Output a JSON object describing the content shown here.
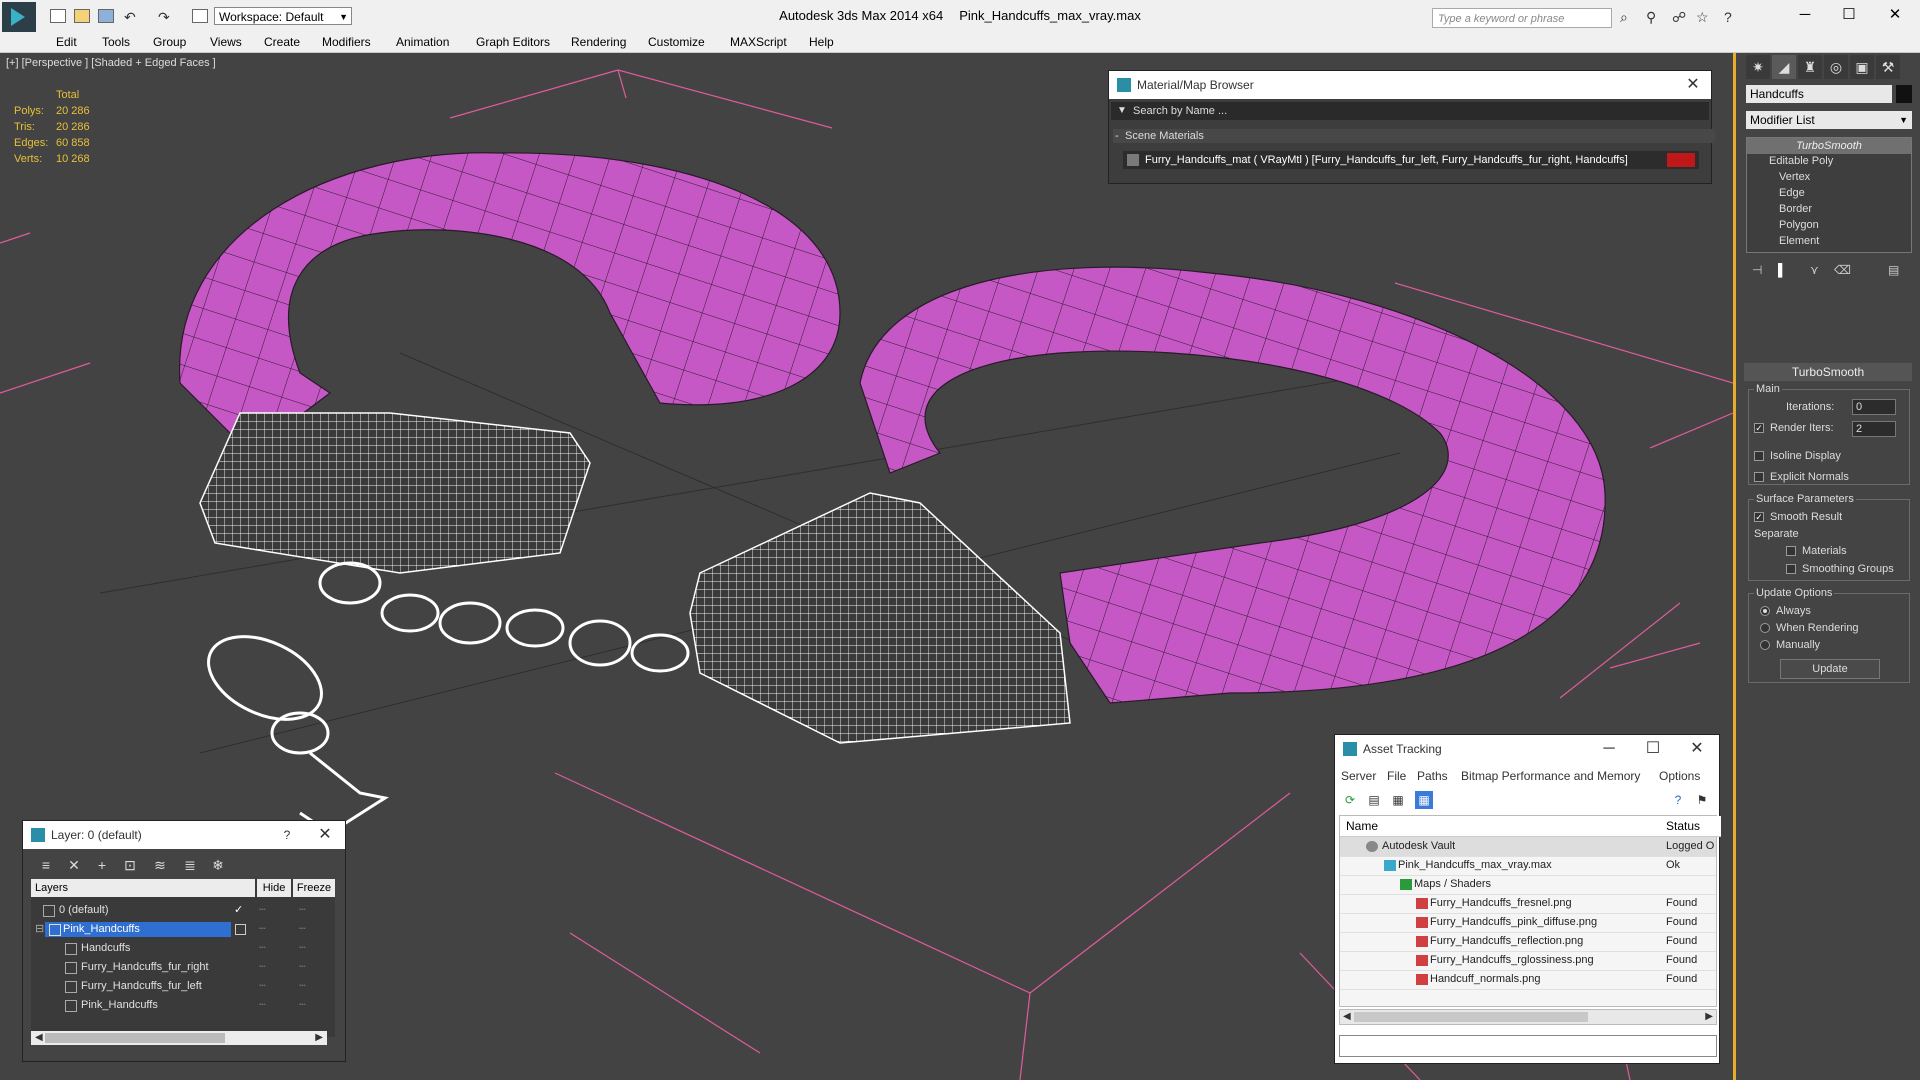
{
  "app": {
    "title": "Autodesk 3ds Max  2014 x64",
    "file": "Pink_Handcuffs_max_vray.max",
    "workspace": "Workspace: Default",
    "search_placeholder": "Type a keyword or phrase"
  },
  "menu": [
    "Edit",
    "Tools",
    "Group",
    "Views",
    "Create",
    "Modifiers",
    "Animation",
    "Graph Editors",
    "Rendering",
    "Customize",
    "MAXScript",
    "Help"
  ],
  "viewport": {
    "label": "[+] [Perspective ] [Shaded + Edged Faces ]",
    "stats": {
      "header": "Total",
      "rows": [
        {
          "label": "Polys:",
          "value": "20 286"
        },
        {
          "label": "Tris:",
          "value": "20 286"
        },
        {
          "label": "Edges:",
          "value": "60 858"
        },
        {
          "label": "Verts:",
          "value": "10 268"
        }
      ]
    },
    "colors": {
      "background": "#434343",
      "mesh": "#c257c2",
      "wire": "#ffffff",
      "grid": "#e05b9e"
    }
  },
  "command_panel": {
    "object_name": "Handcuffs",
    "modifier_list": "Modifier List",
    "stack": [
      "TurboSmooth",
      "Editable Poly",
      "Vertex",
      "Edge",
      "Border",
      "Polygon",
      "Element"
    ],
    "turbosmooth": {
      "title": "TurboSmooth",
      "main": "Main",
      "iterations_label": "Iterations:",
      "iterations": "0",
      "render_iters_label": "Render Iters:",
      "render_iters": "2",
      "isoline": "Isoline Display",
      "explicit": "Explicit Normals",
      "surface": "Surface Parameters",
      "smooth_result": "Smooth Result",
      "separate": "Separate",
      "materials": "Materials",
      "smoothing_groups": "Smoothing Groups",
      "update_options": "Update Options",
      "always": "Always",
      "when_rendering": "When Rendering",
      "manually": "Manually",
      "update": "Update"
    }
  },
  "material_browser": {
    "title": "Material/Map Browser",
    "search": "Search by Name ...",
    "section": "Scene Materials",
    "item": "Furry_Handcuffs_mat  ( VRayMtl ) [Furry_Handcuffs_fur_left, Furry_Handcuffs_fur_right, Handcuffs]",
    "swatch_color": "#c01818"
  },
  "layer_panel": {
    "title": "Layer: 0 (default)",
    "help": "?",
    "col_layers": "Layers",
    "col_hide": "Hide",
    "col_freeze": "Freeze",
    "rows": [
      {
        "name": "0 (default)"
      },
      {
        "name": "Pink_Handcuffs"
      },
      {
        "name": "Handcuffs"
      },
      {
        "name": "Furry_Handcuffs_fur_right"
      },
      {
        "name": "Furry_Handcuffs_fur_left"
      },
      {
        "name": "Pink_Handcuffs"
      }
    ]
  },
  "asset_tracking": {
    "title": "Asset Tracking",
    "menu": [
      "Server",
      "File",
      "Paths",
      "Bitmap Performance and Memory",
      "Options"
    ],
    "col_name": "Name",
    "col_status": "Status",
    "rows": [
      {
        "name": "Autodesk Vault",
        "status": "Logged O"
      },
      {
        "name": "Pink_Handcuffs_max_vray.max",
        "status": "Ok"
      },
      {
        "name": "Maps / Shaders",
        "status": ""
      },
      {
        "name": "Furry_Handcuffs_fresnel.png",
        "status": "Found"
      },
      {
        "name": "Furry_Handcuffs_pink_diffuse.png",
        "status": "Found"
      },
      {
        "name": "Furry_Handcuffs_reflection.png",
        "status": "Found"
      },
      {
        "name": "Furry_Handcuffs_rglossiness.png",
        "status": "Found"
      },
      {
        "name": "Handcuff_normals.png",
        "status": "Found"
      }
    ]
  }
}
